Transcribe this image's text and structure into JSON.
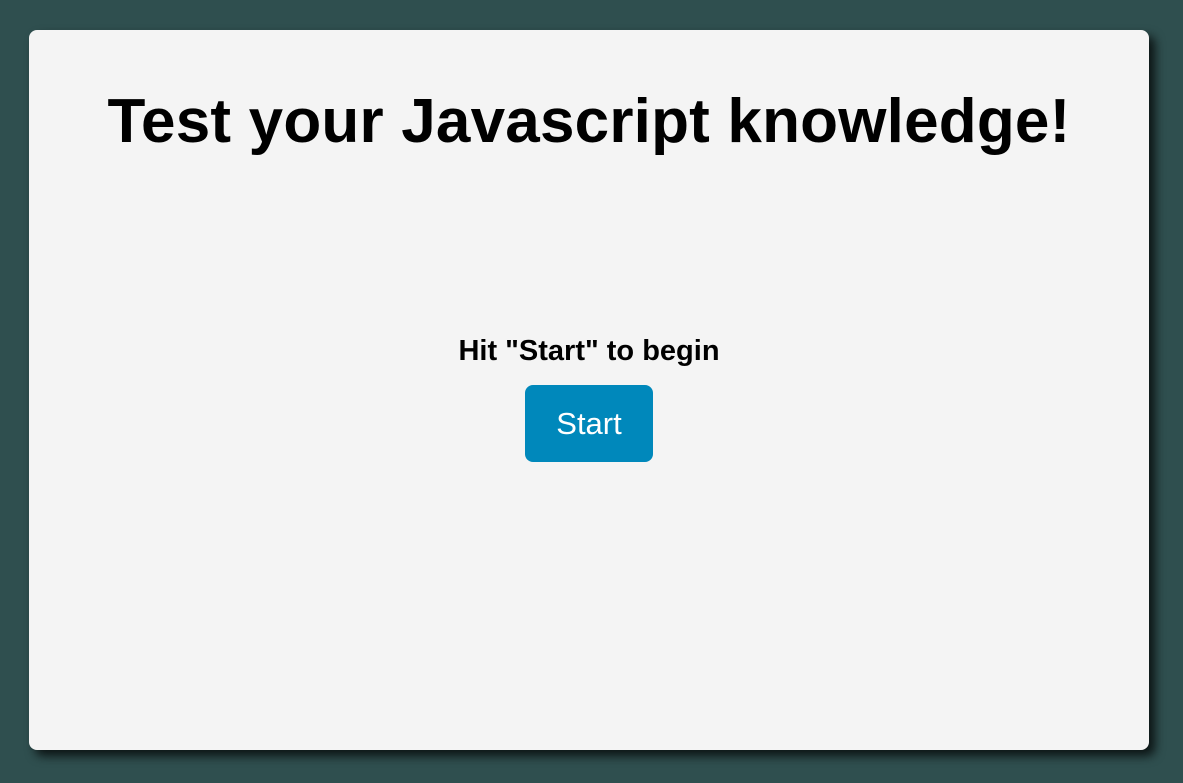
{
  "quiz": {
    "title": "Test your Javascript knowledge!",
    "prompt": "Hit \"Start\" to begin",
    "start_label": "Start"
  },
  "colors": {
    "background": "#2f4f4f",
    "card": "#f4f4f4",
    "button": "#0088bb",
    "button_text": "#ffffff",
    "text": "#000000"
  }
}
